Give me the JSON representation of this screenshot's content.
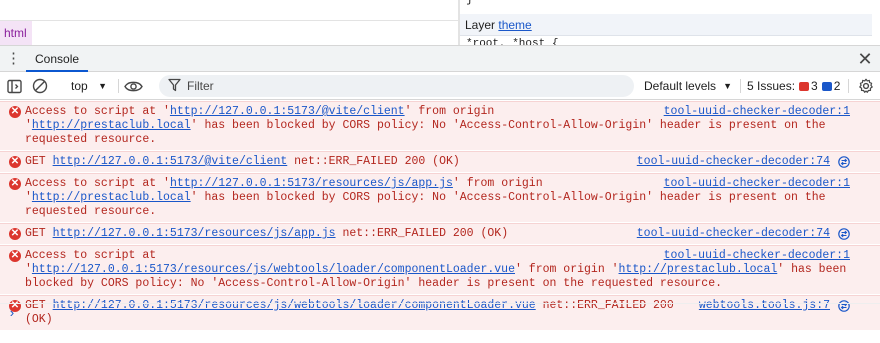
{
  "elements_panel": {
    "styles_brace": "}",
    "breadcrumb_html": "html",
    "layer_label": "Layer",
    "layer_link": "theme",
    "rule_peek": "*root, *host {"
  },
  "drawer": {
    "menu_icon": "kebab-menu-icon",
    "tab_console": "Console",
    "close_icon": "close-icon"
  },
  "toolbar": {
    "context": "top",
    "filter_placeholder": "Filter",
    "levels": "Default levels",
    "issues_label": "5 Issues:",
    "issues_errors": "3",
    "issues_info": "2"
  },
  "messages": [
    {
      "kind": "cors",
      "pre": "Access to script at '",
      "url": "http://127.0.0.1:5173/@vite/client",
      "mid": "' from origin '",
      "origin": "http://prestaclub.local",
      "post": "' has been blocked by CORS policy: No 'Access-Control-Allow-Origin' header is present on the requested resource.",
      "source": "tool-uuid-checker-decoder:1"
    },
    {
      "kind": "get",
      "pre": "GET ",
      "url": "http://127.0.0.1:5173/@vite/client",
      "post": " net::ERR_FAILED 200 (OK)",
      "source": "tool-uuid-checker-decoder:74"
    },
    {
      "kind": "cors",
      "pre": "Access to script at '",
      "url": "http://127.0.0.1:5173/resources/js/app.js",
      "mid": "' from origin '",
      "origin": "http://prestaclub.local",
      "post": "' has been blocked by CORS policy: No 'Access-Control-Allow-Origin' header is present on the requested resource.",
      "source": "tool-uuid-checker-decoder:1"
    },
    {
      "kind": "get",
      "pre": "GET ",
      "url": "http://127.0.0.1:5173/resources/js/app.js",
      "post": " net::ERR_FAILED 200 (OK)",
      "source": "tool-uuid-checker-decoder:74"
    },
    {
      "kind": "cors",
      "pre": "Access to script at '",
      "url": "http://127.0.0.1:5173/resources/js/webtools/loader/componentLoader.vue",
      "mid": "' from origin '",
      "origin": "http://prestaclub.local",
      "post": "' has been blocked by CORS policy: No 'Access-Control-Allow-Origin' header is present on the requested resource.",
      "source": "tool-uuid-checker-decoder:1"
    },
    {
      "kind": "get",
      "pre": "GET ",
      "url": "http://127.0.0.1:5173/resources/js/webtools/loader/componentLoader.vue",
      "post": " net::ERR_FAILED 200 (OK)",
      "source": "webtools.tools.js:7"
    }
  ],
  "prompt_symbol": "›",
  "colors": {
    "error_bg": "#fceeee",
    "error_text": "#b3261e",
    "link": "#1a57c9",
    "accent": "#0b57d0"
  }
}
